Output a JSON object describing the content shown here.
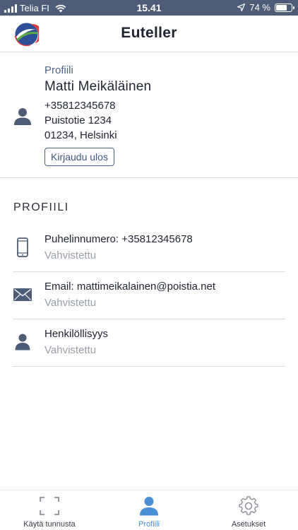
{
  "status_bar": {
    "carrier": "Telia FI",
    "time": "15.41",
    "battery": "74 %",
    "battery_level": 0.74
  },
  "header": {
    "title": "Euteller",
    "logo_icon": "euteller-logo"
  },
  "profile_summary": {
    "label": "Profiili",
    "name": "Matti Meikäläinen",
    "phone": "+35812345678",
    "street": "Puistotie 1234",
    "postal_city": "01234, Helsinki",
    "logout_label": "Kirjaudu ulos",
    "icon": "person-icon"
  },
  "section": {
    "title": "PROFIILI",
    "rows": [
      {
        "title": "Puhelinnumero: +35812345678",
        "status": "Vahvistettu",
        "icon": "phone-icon"
      },
      {
        "title": "Email: mattimeikalainen@poistia.net",
        "status": "Vahvistettu",
        "icon": "envelope-icon"
      },
      {
        "title": "Henkilöllisyys",
        "status": "Vahvistettu",
        "icon": "person-icon"
      }
    ]
  },
  "tab_bar": {
    "tabs": [
      {
        "label": "Käytä tunnusta",
        "icon": "scan-frame-icon",
        "active": false
      },
      {
        "label": "Profiili",
        "icon": "person-icon",
        "active": true
      },
      {
        "label": "Asetukset",
        "icon": "gear-icon",
        "active": false
      }
    ]
  },
  "colors": {
    "status_bar": "#4d5c77",
    "accent": "#4b8fd6",
    "icon": "#4d5c77",
    "muted": "#9aa0a8"
  }
}
